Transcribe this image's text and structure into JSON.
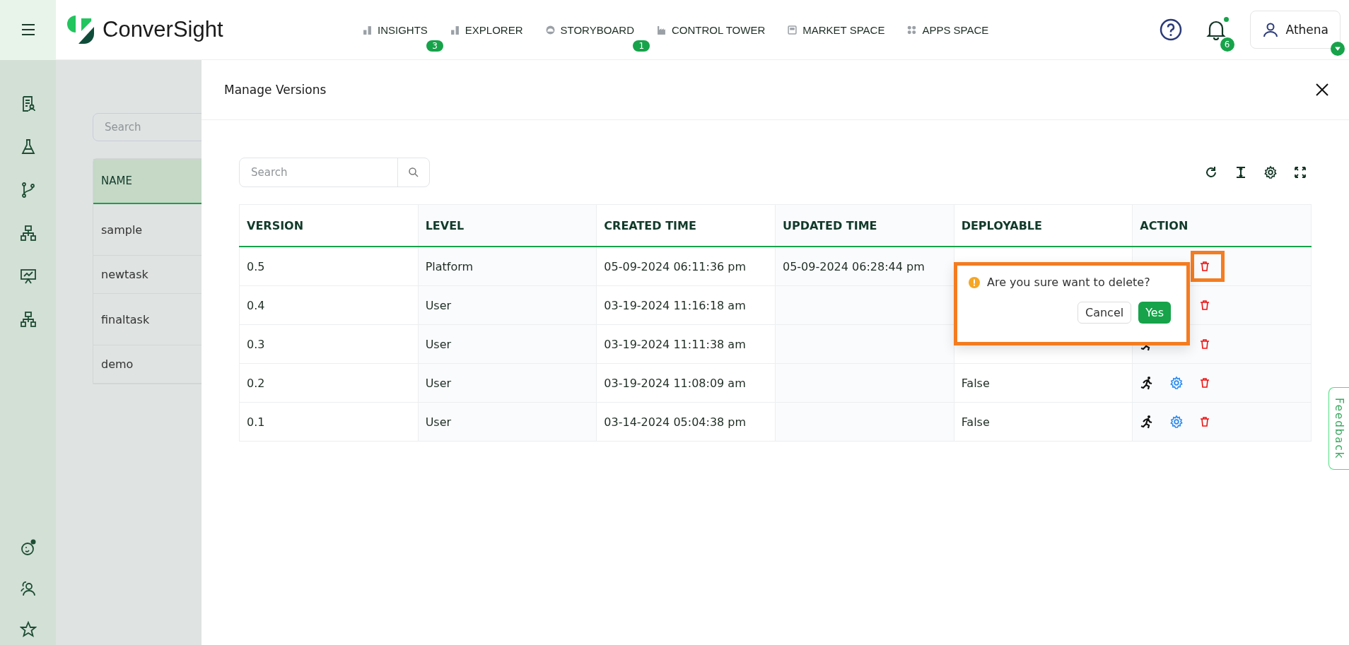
{
  "brand": {
    "name": "ConverSight"
  },
  "nav": [
    {
      "label": "INSIGHTS",
      "badge": "3",
      "kind": "bars"
    },
    {
      "label": "EXPLORER",
      "kind": "bars"
    },
    {
      "label": "STORYBOARD",
      "badge": "1",
      "kind": "gauge"
    },
    {
      "label": "CONTROL TOWER",
      "kind": "factory"
    },
    {
      "label": "MARKET SPACE",
      "kind": "store"
    },
    {
      "label": "APPS SPACE",
      "kind": "dots"
    }
  ],
  "notifications": {
    "count": "6"
  },
  "user": {
    "name": "Athena"
  },
  "background_list": {
    "search_placeholder": "Search",
    "header": "NAME",
    "rows": [
      "sample",
      "newtask",
      "finaltask",
      "demo"
    ]
  },
  "drawer": {
    "title": "Manage Versions",
    "search_placeholder": "Search",
    "columns": [
      "VERSION",
      "LEVEL",
      "CREATED TIME",
      "UPDATED TIME",
      "DEPLOYABLE",
      "ACTION"
    ],
    "rows": [
      {
        "version": "0.5",
        "level": "Platform",
        "created": "05-09-2024 06:11:36 pm",
        "updated": "05-09-2024 06:28:44 pm"
      },
      {
        "version": "0.4",
        "level": "User",
        "created": "03-19-2024 11:16:18 am"
      },
      {
        "version": "0.3",
        "level": "User",
        "created": "03-19-2024 11:11:38 am"
      },
      {
        "version": "0.2",
        "level": "User",
        "created": "03-19-2024 11:08:09 am",
        "deployable": "False"
      },
      {
        "version": "0.1",
        "level": "User",
        "created": "03-14-2024 05:04:38 pm",
        "deployable": "False"
      }
    ],
    "confirm": {
      "message": "Are you sure want to delete?",
      "cancel": "Cancel",
      "ok": "Yes"
    }
  },
  "feedback": "Feedback"
}
